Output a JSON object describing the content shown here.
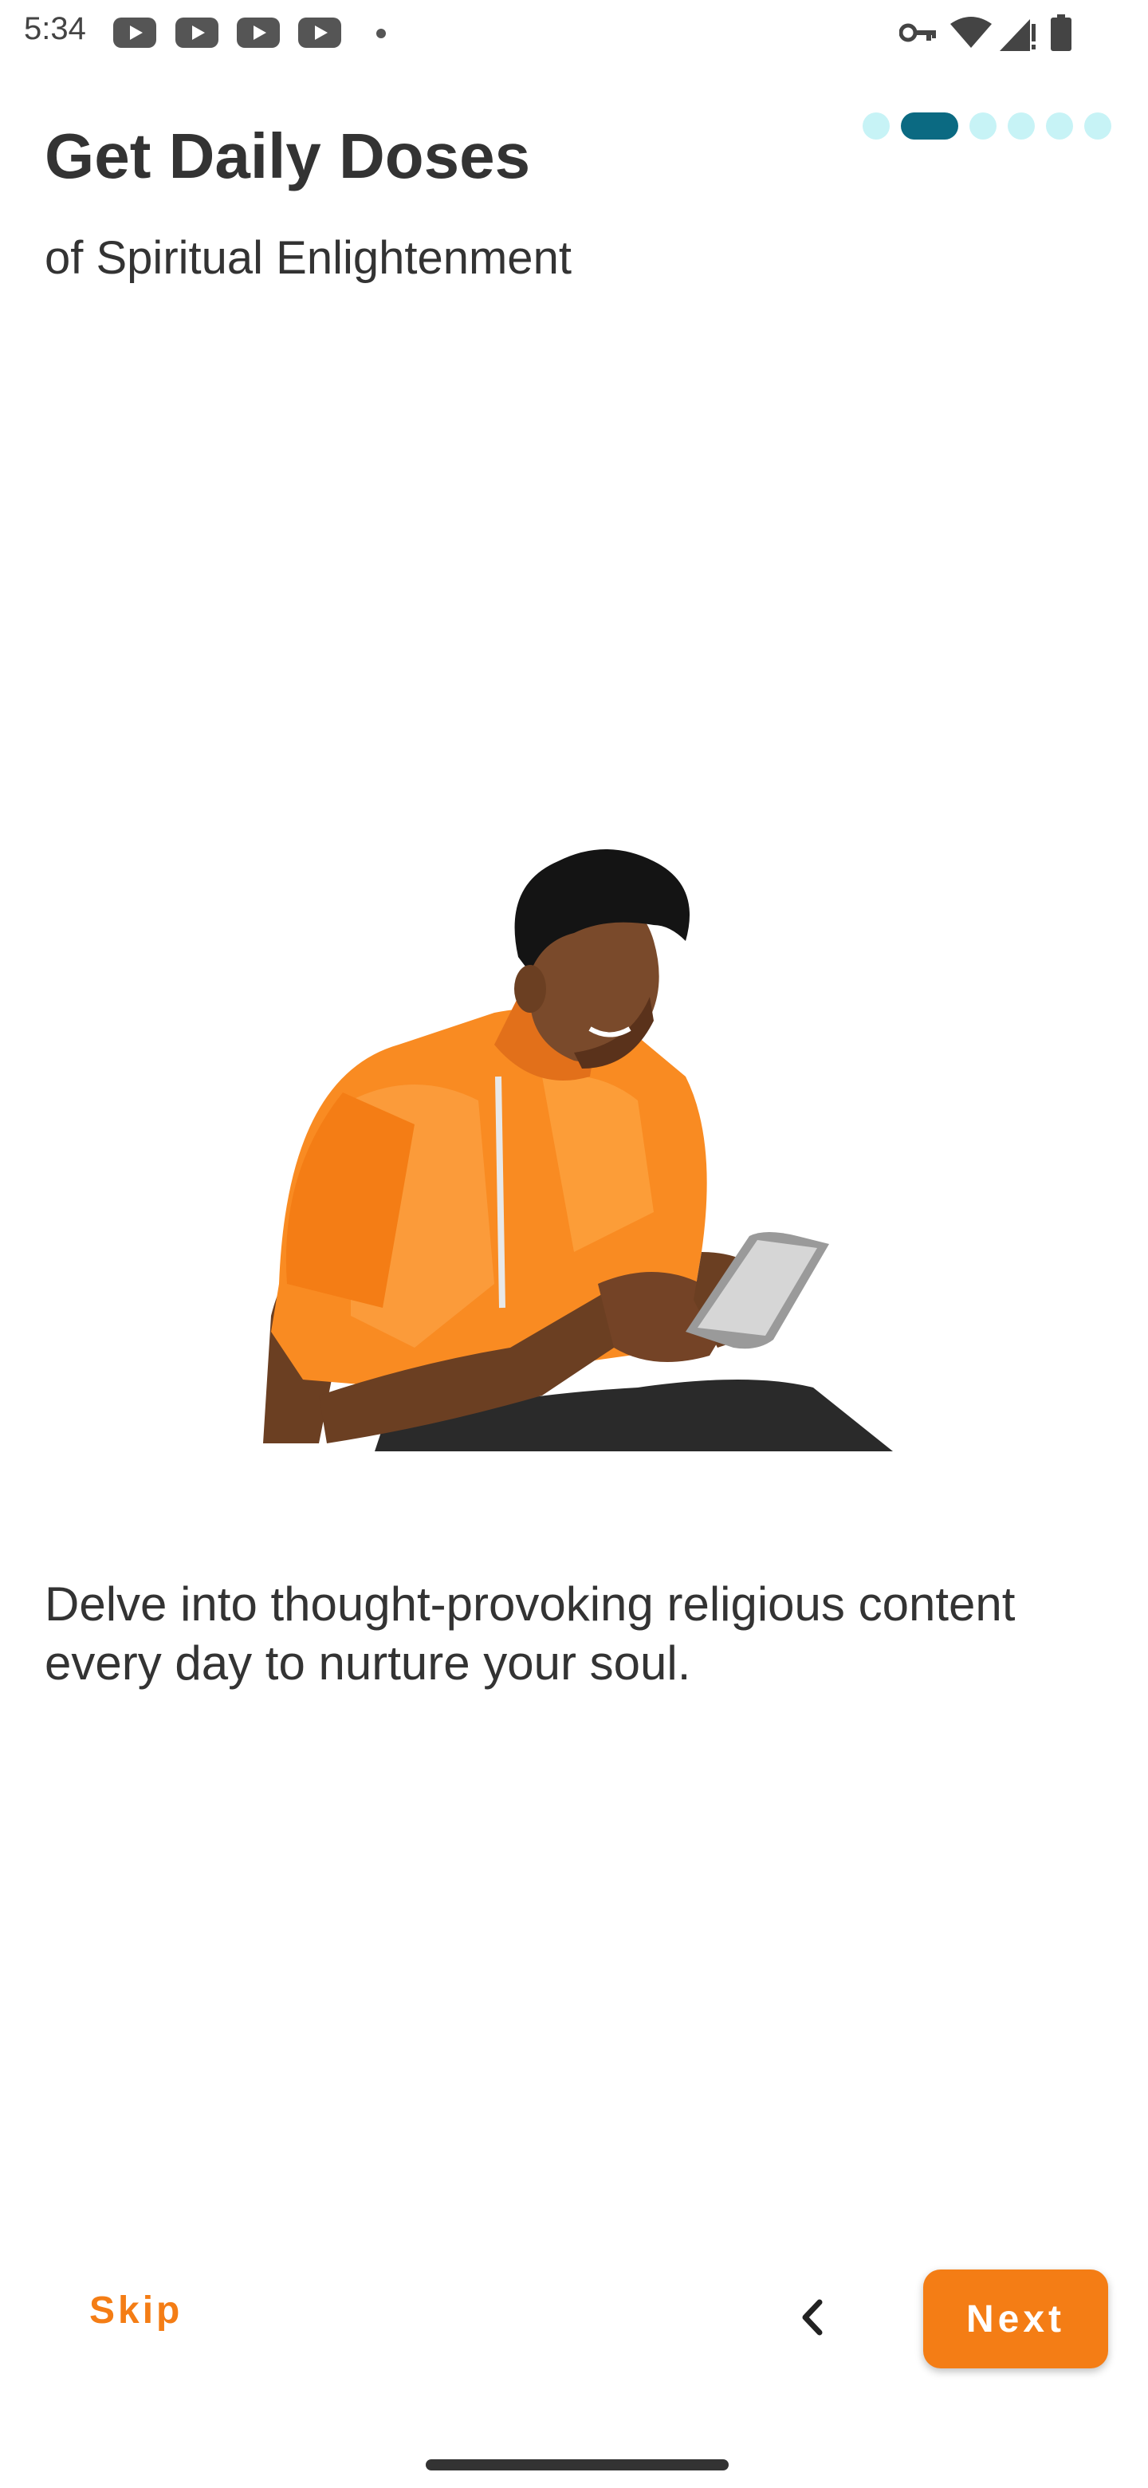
{
  "status_bar": {
    "time": "5:34",
    "notification_icons": [
      "youtube-icon",
      "youtube-icon",
      "youtube-icon",
      "youtube-icon"
    ],
    "system_icons": [
      "vpn-key-icon",
      "wifi-icon",
      "signal-icon",
      "battery-icon"
    ]
  },
  "onboarding": {
    "pages_total": 6,
    "active_page": 2,
    "title": "Get Daily Doses",
    "subtitle": "of Spiritual Enlightenment",
    "description": "Delve into thought-provoking religious content every day to nurture your soul.",
    "illustration": "person-with-phone-illustration"
  },
  "footer": {
    "skip_label": "Skip",
    "back_icon": "chevron-left-icon",
    "next_label": "Next"
  },
  "colors": {
    "accent": "#f47d15",
    "indicator_active": "#0b6a82",
    "indicator_inactive": "#c7f3f6",
    "text": "#333333"
  }
}
